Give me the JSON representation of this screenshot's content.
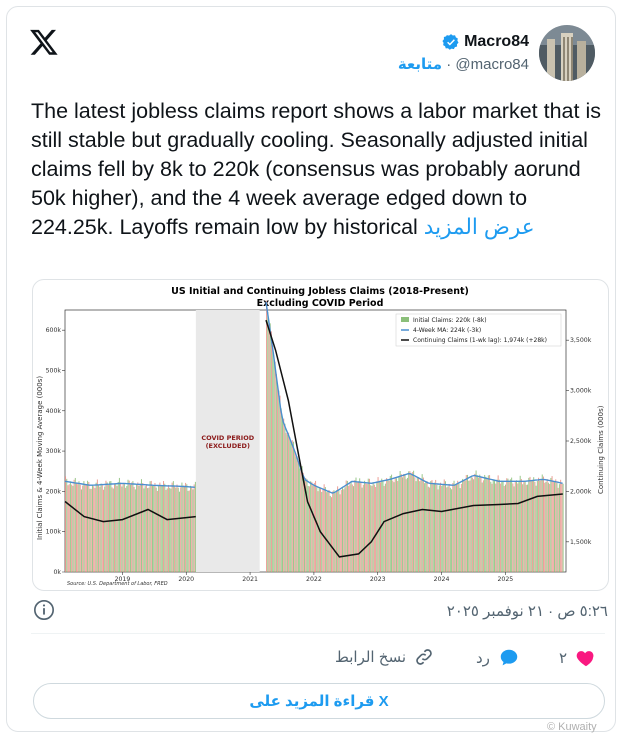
{
  "author": {
    "display_name": "Macro84",
    "handle": "@macro84",
    "separator": "·",
    "follow_label": "متابعة",
    "verified_icon": "verified-badge-icon"
  },
  "tweet": {
    "text": "The latest jobless claims report shows a labor market that is still stable but gradually cooling. Seasonally adjusted initial claims fell by 8k to 220k (consensus was probably aorund 50k higher), and the 4 week average edged down to 224.25k. Layoffs remain low by historical",
    "show_more": "عرض المزيد",
    "timestamp": "٥:٢٦ ص · ٢١ نوفمبر ٢٠٢٥"
  },
  "actions": {
    "like_count": "٢",
    "reply_label": "رد",
    "copy_link_label": "نسخ الرابط",
    "read_more_label": "قراءة المزيد على X"
  },
  "watermark": "© Kuwaity",
  "colors": {
    "accent": "#1d9bf0",
    "like": "#f91880",
    "muted": "#536471"
  },
  "chart_data": {
    "type": "bar",
    "title": "US Initial and Continuing Jobless Claims (2018-Present)",
    "subtitle": "Excluding COVID Period",
    "ylabel_left": "Initial Claims & 4-Week Moving Average (000s)",
    "ylabel_right": "Continuing Claims (000s)",
    "source": "Source: U.S. Department of Labor, FRED",
    "shaded_label": "COVID PERIOD (EXCLUDED)",
    "left_ticks": [
      "0k",
      "100k",
      "200k",
      "300k",
      "400k",
      "500k",
      "600k"
    ],
    "right_ticks": [
      "1,500k",
      "2,000k",
      "2,500k",
      "3,000k",
      "3,500k"
    ],
    "x_ticks": [
      "2019",
      "2020",
      "2021",
      "2022",
      "2023",
      "2024",
      "2025"
    ],
    "legend": [
      "Initial Claims: 220k (-8k)",
      "4-Week MA: 224k (-3k)",
      "Continuing Claims (1-wk lag): 1,974k (+28k)"
    ],
    "ylim_left": [
      0,
      650
    ],
    "ylim_right": [
      1200,
      3800
    ],
    "xlim": [
      2018.1,
      2025.95
    ],
    "covid_excluded": [
      2020.15,
      2021.15
    ],
    "initial_claims": [
      [
        2018.1,
        225
      ],
      [
        2018.5,
        215
      ],
      [
        2019.0,
        220
      ],
      [
        2019.5,
        215
      ],
      [
        2020.0,
        212
      ],
      [
        2020.15,
        210
      ],
      [
        2021.25,
        670
      ],
      [
        2021.35,
        560
      ],
      [
        2021.5,
        380
      ],
      [
        2021.7,
        300
      ],
      [
        2021.85,
        230
      ],
      [
        2022.0,
        215
      ],
      [
        2022.3,
        195
      ],
      [
        2022.6,
        225
      ],
      [
        2022.9,
        220
      ],
      [
        2023.2,
        230
      ],
      [
        2023.5,
        245
      ],
      [
        2023.8,
        220
      ],
      [
        2024.2,
        215
      ],
      [
        2024.5,
        240
      ],
      [
        2024.9,
        225
      ],
      [
        2025.3,
        225
      ],
      [
        2025.6,
        230
      ],
      [
        2025.9,
        220
      ]
    ],
    "continuing_claims": [
      [
        2018.1,
        1900
      ],
      [
        2018.4,
        1750
      ],
      [
        2018.7,
        1700
      ],
      [
        2019.0,
        1720
      ],
      [
        2019.4,
        1820
      ],
      [
        2019.7,
        1720
      ],
      [
        2020.0,
        1740
      ],
      [
        2020.15,
        1750
      ],
      [
        2021.25,
        3700
      ],
      [
        2021.4,
        3400
      ],
      [
        2021.6,
        2900
      ],
      [
        2021.75,
        2400
      ],
      [
        2021.9,
        1900
      ],
      [
        2022.1,
        1600
      ],
      [
        2022.4,
        1350
      ],
      [
        2022.7,
        1380
      ],
      [
        2022.9,
        1500
      ],
      [
        2023.1,
        1700
      ],
      [
        2023.4,
        1780
      ],
      [
        2023.7,
        1820
      ],
      [
        2024.0,
        1800
      ],
      [
        2024.5,
        1860
      ],
      [
        2024.9,
        1870
      ],
      [
        2025.2,
        1880
      ],
      [
        2025.5,
        1950
      ],
      [
        2025.9,
        1974
      ]
    ]
  }
}
